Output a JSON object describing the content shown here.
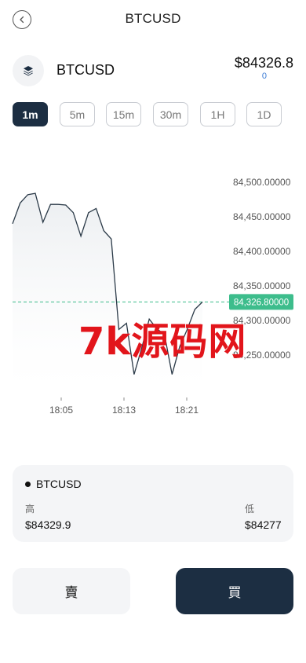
{
  "header": {
    "title": "BTCUSD"
  },
  "symbol": {
    "name": "BTCUSD",
    "price": "$84326.8",
    "change": "0",
    "icon": "layers-icon"
  },
  "intervals": [
    {
      "label": "1m",
      "active": true
    },
    {
      "label": "5m",
      "active": false
    },
    {
      "label": "15m",
      "active": false
    },
    {
      "label": "30m",
      "active": false
    },
    {
      "label": "1H",
      "active": false
    },
    {
      "label": "1D",
      "active": false
    }
  ],
  "chart_data": {
    "type": "area",
    "current_value": 84326.8,
    "current_label": "84,326.80000",
    "y_ticks": [
      {
        "value": 84500,
        "label": "84,500.00000"
      },
      {
        "value": 84450,
        "label": "84,450.00000"
      },
      {
        "value": 84400,
        "label": "84,400.00000"
      },
      {
        "value": 84350,
        "label": "84,350.00000"
      },
      {
        "value": 84300,
        "label": "84,300.00000"
      },
      {
        "value": 84250,
        "label": "84,250.00000"
      }
    ],
    "x_ticks": [
      {
        "label": "18:05"
      },
      {
        "label": "18:13"
      },
      {
        "label": "18:21"
      }
    ],
    "line_color": "#2b3a48",
    "current_line_color": "#3dbd8c",
    "points": [
      84440,
      84470,
      84482,
      84484,
      84442,
      84468,
      84468,
      84467,
      84456,
      84422,
      84456,
      84462,
      84430,
      84418,
      84287,
      84296,
      84222,
      84260,
      84302,
      84288,
      84280,
      84222,
      84262,
      84287,
      84316,
      84326.8
    ]
  },
  "info": {
    "symbol": "BTCUSD",
    "high_label": "高",
    "high_value": "$84329.9",
    "low_label": "低",
    "low_value": "$84277"
  },
  "actions": {
    "sell": "賣",
    "buy": "買"
  },
  "watermark": "7k源码网"
}
